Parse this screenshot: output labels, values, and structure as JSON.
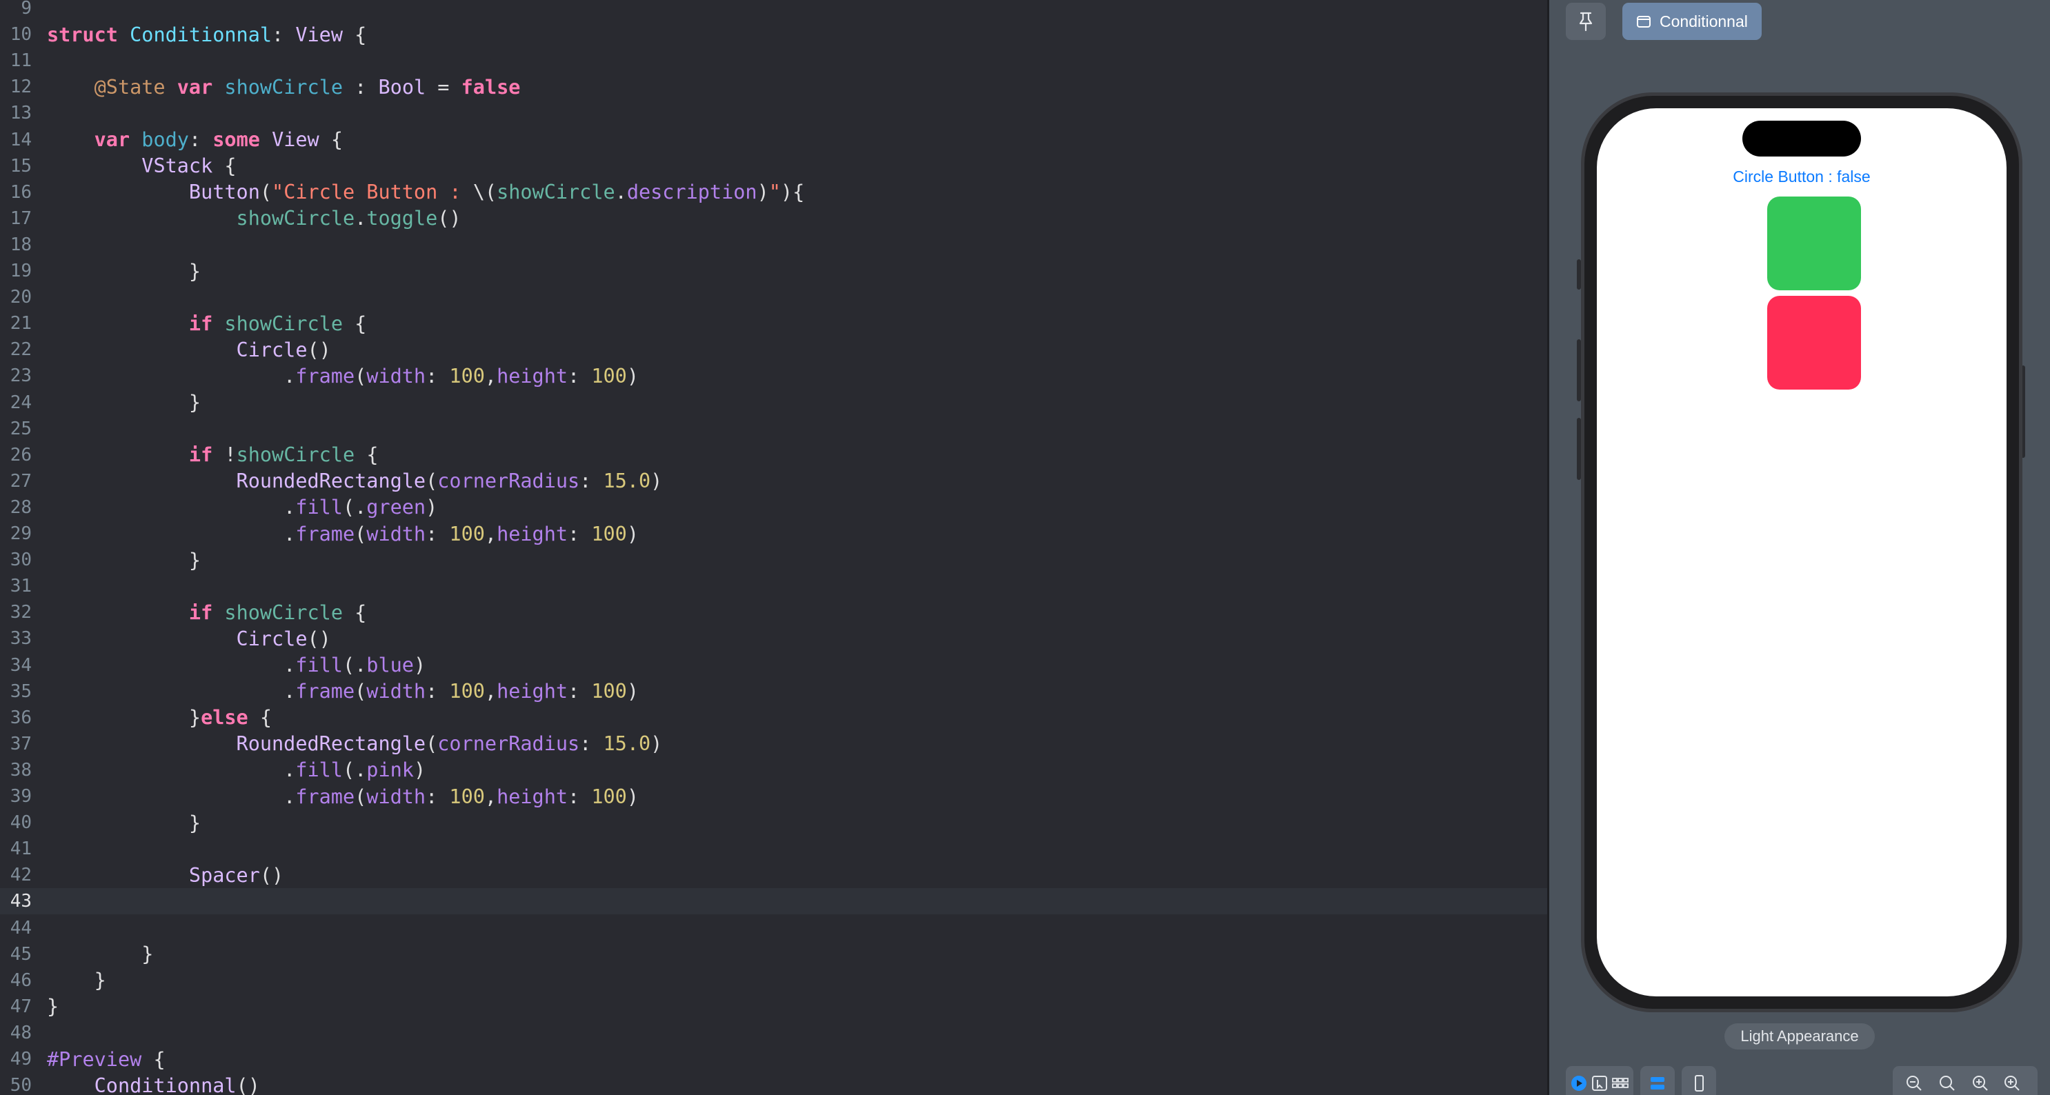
{
  "editor": {
    "current_line": "43",
    "lines": [
      {
        "n": "9",
        "tokens": []
      },
      {
        "n": "10",
        "tokens": [
          [
            "kw",
            "struct"
          ],
          [
            "plain",
            " "
          ],
          [
            "tdecl",
            "Conditionnal"
          ],
          [
            "plain",
            ": "
          ],
          [
            "type",
            "View"
          ],
          [
            "plain",
            " {"
          ]
        ]
      },
      {
        "n": "11",
        "tokens": []
      },
      {
        "n": "12",
        "tokens": [
          [
            "plain",
            "    "
          ],
          [
            "attr",
            "@State"
          ],
          [
            "plain",
            " "
          ],
          [
            "kw",
            "var"
          ],
          [
            "plain",
            " "
          ],
          [
            "decl",
            "showCircle"
          ],
          [
            "plain",
            " : "
          ],
          [
            "type",
            "Bool"
          ],
          [
            "plain",
            " = "
          ],
          [
            "kw",
            "false"
          ]
        ]
      },
      {
        "n": "13",
        "tokens": []
      },
      {
        "n": "14",
        "tokens": [
          [
            "plain",
            "    "
          ],
          [
            "kw",
            "var"
          ],
          [
            "plain",
            " "
          ],
          [
            "decl",
            "body"
          ],
          [
            "plain",
            ": "
          ],
          [
            "kw",
            "some"
          ],
          [
            "plain",
            " "
          ],
          [
            "type",
            "View"
          ],
          [
            "plain",
            " {"
          ]
        ]
      },
      {
        "n": "15",
        "tokens": [
          [
            "plain",
            "        "
          ],
          [
            "type",
            "VStack"
          ],
          [
            "plain",
            " {"
          ]
        ]
      },
      {
        "n": "16",
        "tokens": [
          [
            "plain",
            "            "
          ],
          [
            "type",
            "Button"
          ],
          [
            "plain",
            "("
          ],
          [
            "str",
            "\"Circle Button : "
          ],
          [
            "plain",
            "\\("
          ],
          [
            "proj",
            "showCircle"
          ],
          [
            "plain",
            "."
          ],
          [
            "mem",
            "description"
          ],
          [
            "plain",
            ")"
          ],
          [
            "str",
            "\""
          ],
          [
            "plain",
            "){"
          ]
        ]
      },
      {
        "n": "17",
        "tokens": [
          [
            "plain",
            "                "
          ],
          [
            "proj",
            "showCircle"
          ],
          [
            "plain",
            "."
          ],
          [
            "proj",
            "toggle"
          ],
          [
            "plain",
            "()"
          ]
        ]
      },
      {
        "n": "18",
        "tokens": []
      },
      {
        "n": "19",
        "tokens": [
          [
            "plain",
            "            }"
          ]
        ]
      },
      {
        "n": "20",
        "tokens": []
      },
      {
        "n": "21",
        "tokens": [
          [
            "plain",
            "            "
          ],
          [
            "kw",
            "if"
          ],
          [
            "plain",
            " "
          ],
          [
            "proj",
            "showCircle"
          ],
          [
            "plain",
            " {"
          ]
        ]
      },
      {
        "n": "22",
        "tokens": [
          [
            "plain",
            "                "
          ],
          [
            "type",
            "Circle"
          ],
          [
            "plain",
            "()"
          ]
        ]
      },
      {
        "n": "23",
        "tokens": [
          [
            "plain",
            "                    ."
          ],
          [
            "mem",
            "frame"
          ],
          [
            "plain",
            "("
          ],
          [
            "mem",
            "width"
          ],
          [
            "plain",
            ": "
          ],
          [
            "num",
            "100"
          ],
          [
            "plain",
            ","
          ],
          [
            "mem",
            "height"
          ],
          [
            "plain",
            ": "
          ],
          [
            "num",
            "100"
          ],
          [
            "plain",
            ")"
          ]
        ]
      },
      {
        "n": "24",
        "tokens": [
          [
            "plain",
            "            }"
          ]
        ]
      },
      {
        "n": "25",
        "tokens": []
      },
      {
        "n": "26",
        "tokens": [
          [
            "plain",
            "            "
          ],
          [
            "kw",
            "if"
          ],
          [
            "plain",
            " !"
          ],
          [
            "proj",
            "showCircle"
          ],
          [
            "plain",
            " {"
          ]
        ]
      },
      {
        "n": "27",
        "tokens": [
          [
            "plain",
            "                "
          ],
          [
            "type",
            "RoundedRectangle"
          ],
          [
            "plain",
            "("
          ],
          [
            "mem",
            "cornerRadius"
          ],
          [
            "plain",
            ": "
          ],
          [
            "num",
            "15.0"
          ],
          [
            "plain",
            ")"
          ]
        ]
      },
      {
        "n": "28",
        "tokens": [
          [
            "plain",
            "                    ."
          ],
          [
            "mem",
            "fill"
          ],
          [
            "plain",
            "(."
          ],
          [
            "mem",
            "green"
          ],
          [
            "plain",
            ")"
          ]
        ]
      },
      {
        "n": "29",
        "tokens": [
          [
            "plain",
            "                    ."
          ],
          [
            "mem",
            "frame"
          ],
          [
            "plain",
            "("
          ],
          [
            "mem",
            "width"
          ],
          [
            "plain",
            ": "
          ],
          [
            "num",
            "100"
          ],
          [
            "plain",
            ","
          ],
          [
            "mem",
            "height"
          ],
          [
            "plain",
            ": "
          ],
          [
            "num",
            "100"
          ],
          [
            "plain",
            ")"
          ]
        ]
      },
      {
        "n": "30",
        "tokens": [
          [
            "plain",
            "            }"
          ]
        ]
      },
      {
        "n": "31",
        "tokens": []
      },
      {
        "n": "32",
        "tokens": [
          [
            "plain",
            "            "
          ],
          [
            "kw",
            "if"
          ],
          [
            "plain",
            " "
          ],
          [
            "proj",
            "showCircle"
          ],
          [
            "plain",
            " {"
          ]
        ]
      },
      {
        "n": "33",
        "tokens": [
          [
            "plain",
            "                "
          ],
          [
            "type",
            "Circle"
          ],
          [
            "plain",
            "()"
          ]
        ]
      },
      {
        "n": "34",
        "tokens": [
          [
            "plain",
            "                    ."
          ],
          [
            "mem",
            "fill"
          ],
          [
            "plain",
            "(."
          ],
          [
            "mem",
            "blue"
          ],
          [
            "plain",
            ")"
          ]
        ]
      },
      {
        "n": "35",
        "tokens": [
          [
            "plain",
            "                    ."
          ],
          [
            "mem",
            "frame"
          ],
          [
            "plain",
            "("
          ],
          [
            "mem",
            "width"
          ],
          [
            "plain",
            ": "
          ],
          [
            "num",
            "100"
          ],
          [
            "plain",
            ","
          ],
          [
            "mem",
            "height"
          ],
          [
            "plain",
            ": "
          ],
          [
            "num",
            "100"
          ],
          [
            "plain",
            ")"
          ]
        ]
      },
      {
        "n": "36",
        "tokens": [
          [
            "plain",
            "            }"
          ],
          [
            "kw",
            "else"
          ],
          [
            "plain",
            " {"
          ]
        ]
      },
      {
        "n": "37",
        "tokens": [
          [
            "plain",
            "                "
          ],
          [
            "type",
            "RoundedRectangle"
          ],
          [
            "plain",
            "("
          ],
          [
            "mem",
            "cornerRadius"
          ],
          [
            "plain",
            ": "
          ],
          [
            "num",
            "15.0"
          ],
          [
            "plain",
            ")"
          ]
        ]
      },
      {
        "n": "38",
        "tokens": [
          [
            "plain",
            "                    ."
          ],
          [
            "mem",
            "fill"
          ],
          [
            "plain",
            "(."
          ],
          [
            "mem",
            "pink"
          ],
          [
            "plain",
            ")"
          ]
        ]
      },
      {
        "n": "39",
        "tokens": [
          [
            "plain",
            "                    ."
          ],
          [
            "mem",
            "frame"
          ],
          [
            "plain",
            "("
          ],
          [
            "mem",
            "width"
          ],
          [
            "plain",
            ": "
          ],
          [
            "num",
            "100"
          ],
          [
            "plain",
            ","
          ],
          [
            "mem",
            "height"
          ],
          [
            "plain",
            ": "
          ],
          [
            "num",
            "100"
          ],
          [
            "plain",
            ")"
          ]
        ]
      },
      {
        "n": "40",
        "tokens": [
          [
            "plain",
            "            }"
          ]
        ]
      },
      {
        "n": "41",
        "tokens": []
      },
      {
        "n": "42",
        "tokens": [
          [
            "plain",
            "            "
          ],
          [
            "type",
            "Spacer"
          ],
          [
            "plain",
            "()"
          ]
        ]
      },
      {
        "n": "43",
        "tokens": []
      },
      {
        "n": "44",
        "tokens": []
      },
      {
        "n": "45",
        "tokens": [
          [
            "plain",
            "        }"
          ]
        ]
      },
      {
        "n": "46",
        "tokens": [
          [
            "plain",
            "    }"
          ]
        ]
      },
      {
        "n": "47",
        "tokens": [
          [
            "plain",
            "}"
          ]
        ]
      },
      {
        "n": "48",
        "tokens": []
      },
      {
        "n": "49",
        "tokens": [
          [
            "pre",
            "#Preview"
          ],
          [
            "plain",
            " {"
          ]
        ]
      },
      {
        "n": "50",
        "tokens": [
          [
            "plain",
            "    "
          ],
          [
            "type",
            "Conditionnal"
          ],
          [
            "plain",
            "()"
          ]
        ]
      }
    ]
  },
  "canvas": {
    "pin_icon": "pin-icon",
    "preview_tab_label": "Conditionnal",
    "preview_tab_icon": "preview-window-icon",
    "preview": {
      "button_label": "Circle Button : false",
      "button_color": "#0a7aff",
      "green_fill": "#34c759",
      "pink_fill": "#ff2d55"
    },
    "appearance_label": "Light Appearance",
    "bottom_bar_icons": [
      "live-mode-icon",
      "selectable-mode-icon",
      "variants-icon",
      "canvas-settings-icon",
      "device-icon"
    ],
    "zoom_icons": [
      "zoom-out-icon",
      "zoom-fit-icon",
      "zoom-100-icon",
      "zoom-in-icon"
    ]
  }
}
